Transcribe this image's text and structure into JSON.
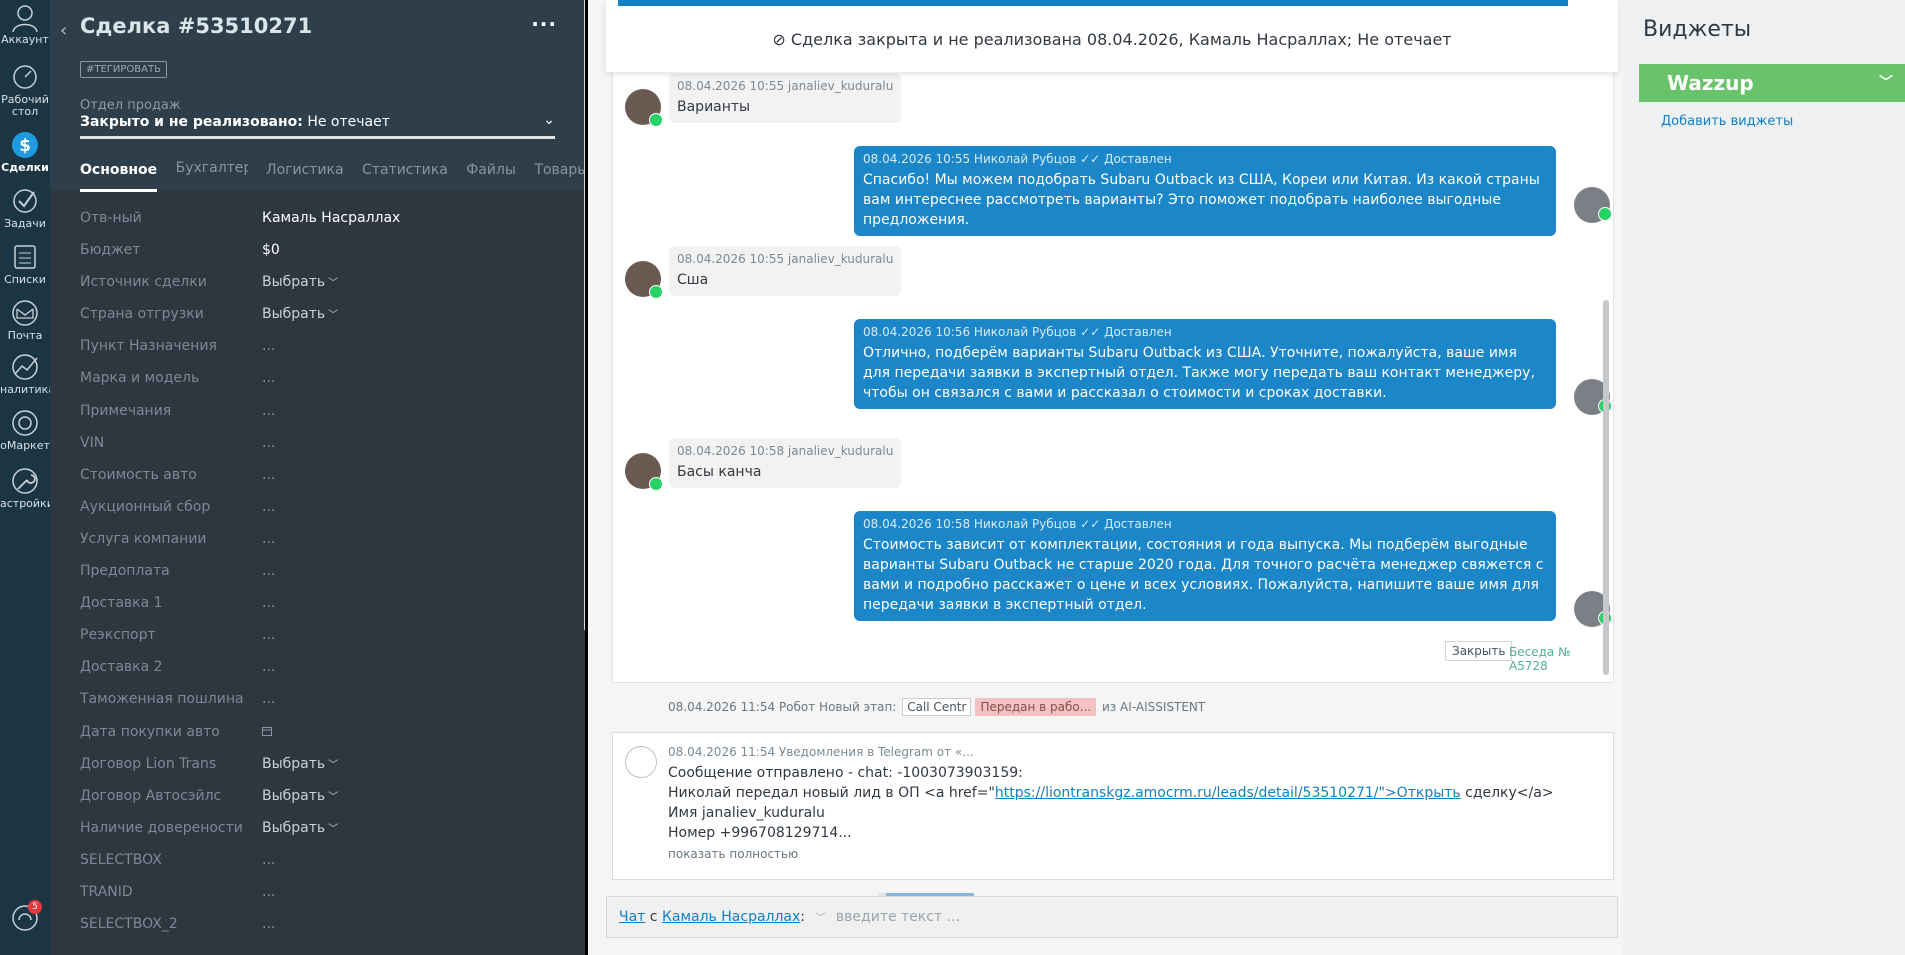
{
  "nav": {
    "items": [
      {
        "key": "account",
        "label": "Аккаунт"
      },
      {
        "key": "dashboard",
        "label": "Рабочий стол"
      },
      {
        "key": "deals",
        "label": "Сделки"
      },
      {
        "key": "tasks",
        "label": "Задачи"
      },
      {
        "key": "lists",
        "label": "Списки"
      },
      {
        "key": "mail",
        "label": "Почта"
      },
      {
        "key": "analytics",
        "label": "налитика"
      },
      {
        "key": "market",
        "label": "оМаркет"
      },
      {
        "key": "settings",
        "label": "астройки"
      }
    ],
    "notifications_count": "5"
  },
  "card": {
    "title": "Сделка #53510271",
    "more": "···",
    "tag_button": "#ТЕГИРОВАТЬ",
    "pipeline": "Отдел продаж",
    "status_bold": "Закрыто и не реализовано:",
    "status_reason": "Не отечает",
    "tabs": [
      "Основное",
      "Бухгалтерия",
      "Логистика",
      "Статистика",
      "Файлы",
      "Товары"
    ],
    "tabs_more": "···",
    "fields": [
      {
        "label": "Отв-ный",
        "value": "Камаль Насраллах"
      },
      {
        "label": "Бюджет",
        "value": "$0"
      },
      {
        "label": "Источник сделки",
        "value": "Выбрать"
      },
      {
        "label": "Страна отгрузки",
        "value": "Выбрать"
      },
      {
        "label": "Пункт Назначения",
        "value": "..."
      },
      {
        "label": "Марка и модель",
        "value": "..."
      },
      {
        "label": "Примечания",
        "value": "..."
      },
      {
        "label": "VIN",
        "value": "..."
      },
      {
        "label": "Стоимость авто",
        "value": "..."
      },
      {
        "label": "Аукционный сбор",
        "value": "..."
      },
      {
        "label": "Услуга компании",
        "value": "..."
      },
      {
        "label": "Предоплата",
        "value": "..."
      },
      {
        "label": "Доставка 1",
        "value": "..."
      },
      {
        "label": "Реэкспорт",
        "value": "..."
      },
      {
        "label": "Доставка 2",
        "value": "..."
      },
      {
        "label": "Таможенная пошлина",
        "value": "..."
      },
      {
        "label": "Дата покупки авто",
        "value": ""
      },
      {
        "label": "Договор Lion Trans",
        "value": "Выбрать"
      },
      {
        "label": "Договор Автосэйлс",
        "value": "Выбрать"
      },
      {
        "label": "Наличие доверености",
        "value": "Выбрать"
      },
      {
        "label": "SELECTBOX",
        "value": "..."
      },
      {
        "label": "TRANID",
        "value": "..."
      },
      {
        "label": "SELECTBOX_2",
        "value": "..."
      }
    ]
  },
  "feed": {
    "closed_banner": "Сделка закрыта и не реализована 08.04.2026, Камаль Насраллах; Не отечает",
    "messages": [
      {
        "dir": "in",
        "meta": "08.04.2026 10:55 janaliev_kuduralu",
        "text": "Варианты"
      },
      {
        "dir": "out",
        "meta": "08.04.2026 10:55 Николай Рубцов",
        "status": "Доставлен",
        "text": "Спасибо! Мы можем подобрать Subaru Outback из США, Кореи или Китая. Из какой страны вам интереснее рассмотреть варианты? Это поможет подобрать наиболее выгодные предложения."
      },
      {
        "dir": "in",
        "meta": "08.04.2026 10:55 janaliev_kuduralu",
        "text": "Сша"
      },
      {
        "dir": "out",
        "meta": "08.04.2026 10:56 Николай Рубцов",
        "status": "Доставлен",
        "text": "Отлично, подберём варианты Subaru Outback из США. Уточните, пожалуйста, ваше имя для передачи заявки в экспертный отдел. Также могу передать ваш контакт менеджеру, чтобы он связался с вами и рассказал о стоимости и сроках доставки."
      },
      {
        "dir": "in",
        "meta": "08.04.2026 10:58 janaliev_kuduralu",
        "text": "Басы канча"
      },
      {
        "dir": "out",
        "meta": "08.04.2026 10:58 Николай Рубцов",
        "status": "Доставлен",
        "text": "Стоимость зависит от комплектации, состояния и года выпуска. Мы подберём выгодные варианты Subaru Outback не старше 2020 года. Для точного расчёта менеджер свяжется с вами и подробно расскажет о цене и всех условиях. Пожалуйста, напишите ваше имя для передачи заявки в экспертный отдел."
      }
    ],
    "close_label": "Закрыть",
    "conversation_label": "Беседа № A5728",
    "event": {
      "text_before": "08.04.2026 11:54 Робот Новый этап:",
      "from_stage": "Call Centr",
      "to_stage": "Передан в рабо...",
      "text_after": "из AI-AISSISTENT"
    },
    "notice": {
      "meta": "08.04.2026 11:54 Уведомления в Telegram от «...",
      "line1": "Сообщение отправлено - chat: -1003073903159:",
      "line2_before": "Николай передал новый лид в ОП <a href=\"",
      "line2_link": "https://liontranskgz.amocrm.ru/leads/detail/53510271/\">Открыть",
      "line2_after": " сделку</a>",
      "line3": "Имя janaliev_kuduralu",
      "line4": "Номер +996708129714...",
      "show_more": "показать полностью"
    },
    "composer": {
      "chat_link": "Чат",
      "with_text": " с ",
      "contact_link": "Камаль Насраллах",
      "colon": ":",
      "placeholder": "введите текст ..."
    }
  },
  "widgets": {
    "title": "Виджеты",
    "wazzup": "Wazzup",
    "add_label": "Добавить виджеты"
  },
  "colors": {
    "outgoing_bubble": "#1b86c8",
    "wazzup_green": "#69c36b",
    "link_blue": "#1281c4",
    "whatsapp_green": "#25d366"
  }
}
